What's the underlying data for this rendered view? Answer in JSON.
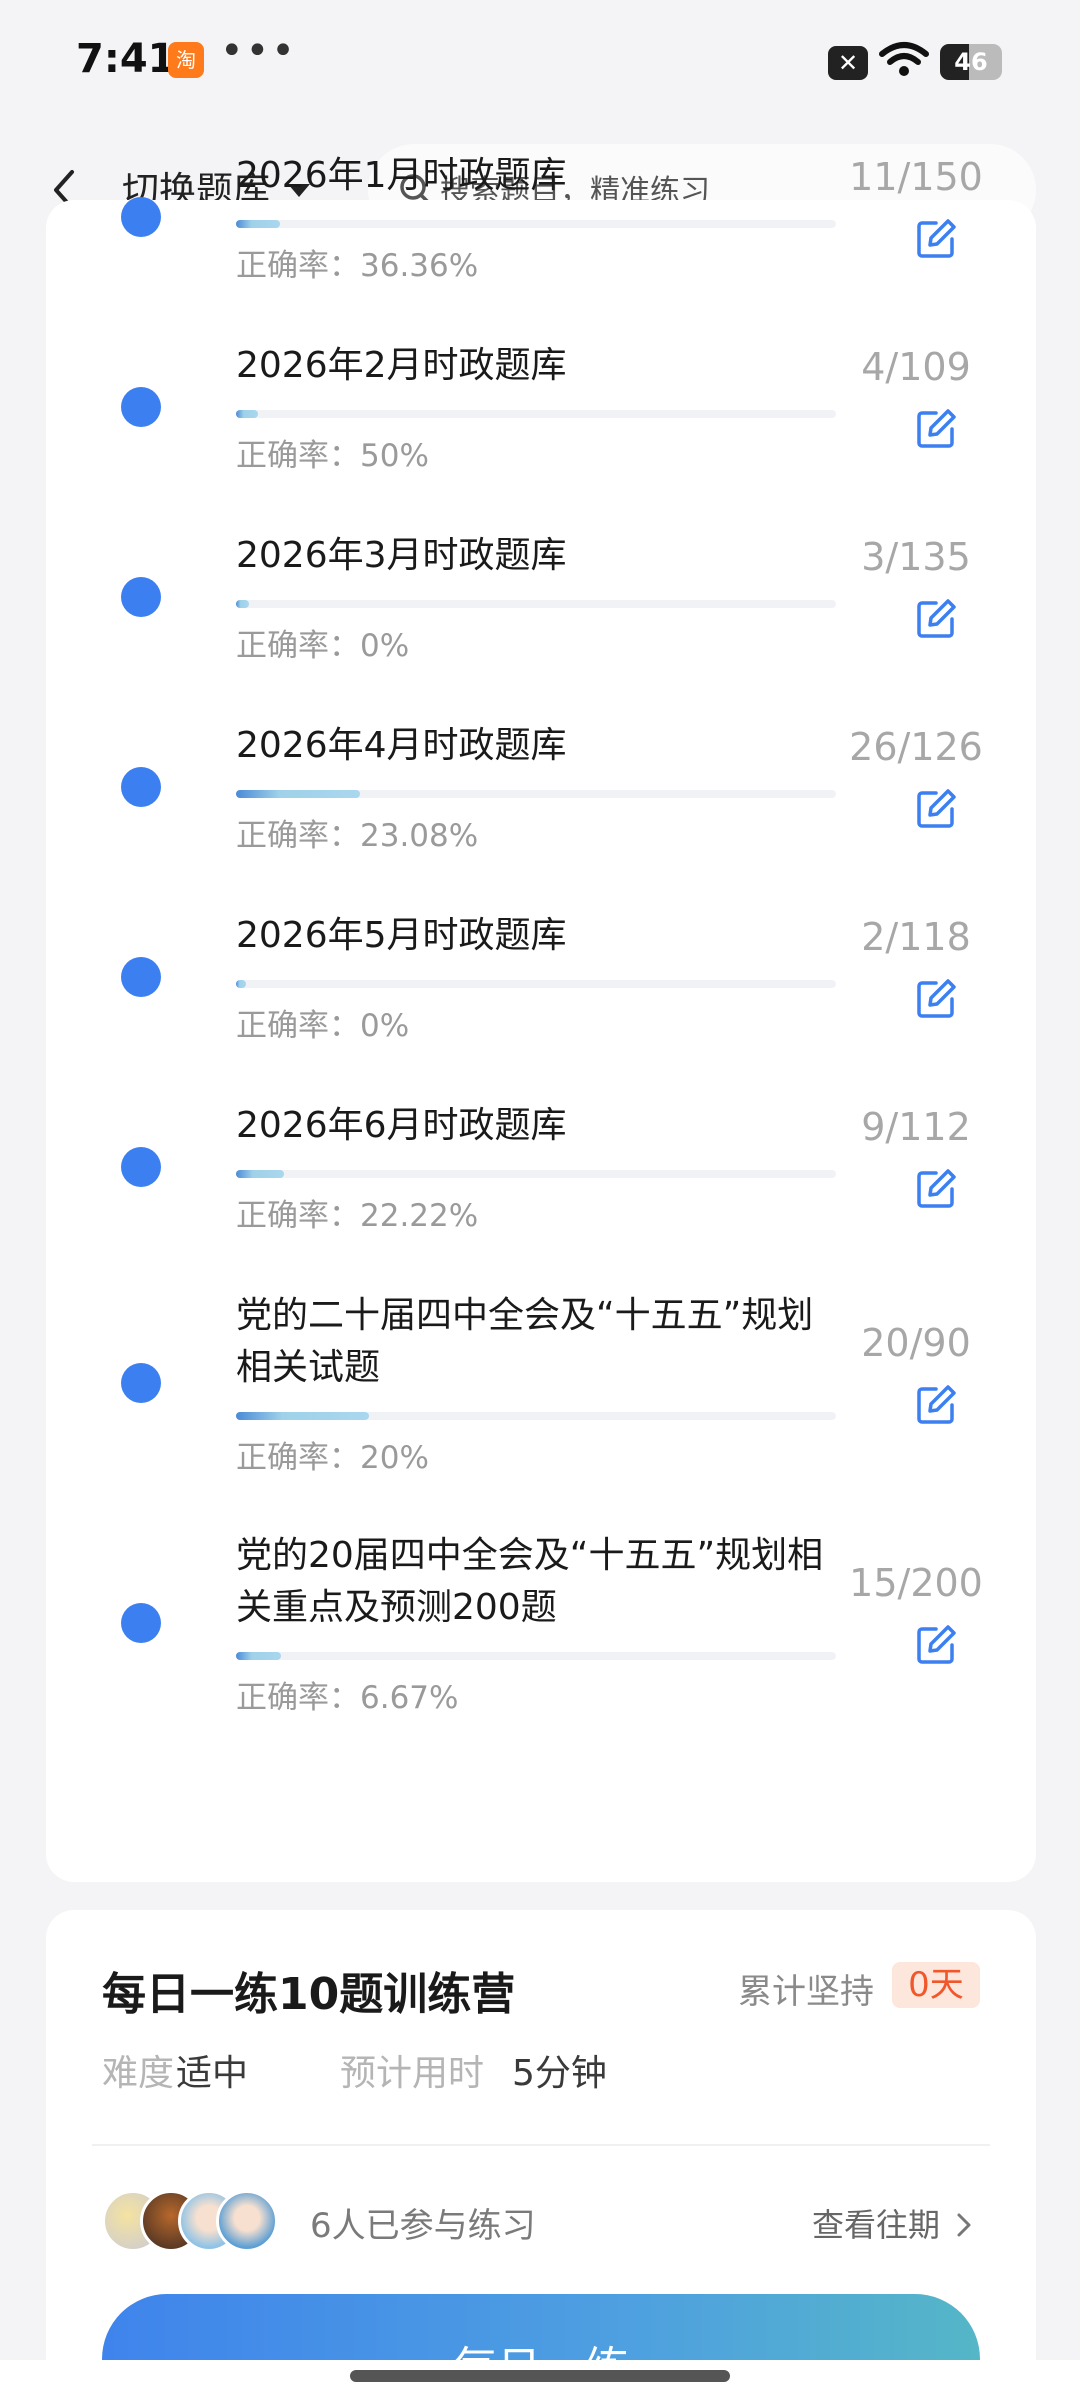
{
  "status_bar": {
    "time": "7:41",
    "app_icon_glyph": "淘",
    "more": "•••",
    "battery": "46"
  },
  "header": {
    "back_icon": "chevron-left-icon",
    "title": "切换题库",
    "search_placeholder": "搜索题目，精准练习"
  },
  "bank_list": {
    "accuracy_prefix": "正确率：",
    "items": [
      {
        "name": "2026年1月时政题库",
        "done": 11,
        "total": 150,
        "count_label": "11/150",
        "accuracy": "36.36%"
      },
      {
        "name": "2026年2月时政题库",
        "done": 4,
        "total": 109,
        "count_label": "4/109",
        "accuracy": "50%"
      },
      {
        "name": "2026年3月时政题库",
        "done": 3,
        "total": 135,
        "count_label": "3/135",
        "accuracy": "0%"
      },
      {
        "name": "2026年4月时政题库",
        "done": 26,
        "total": 126,
        "count_label": "26/126",
        "accuracy": "23.08%"
      },
      {
        "name": "2026年5月时政题库",
        "done": 2,
        "total": 118,
        "count_label": "2/118",
        "accuracy": "0%"
      },
      {
        "name": "2026年6月时政题库",
        "done": 9,
        "total": 112,
        "count_label": "9/112",
        "accuracy": "22.22%"
      },
      {
        "name": "党的二十届四中全会及“十五五”规划相关试题",
        "done": 20,
        "total": 90,
        "count_label": "20/90",
        "accuracy": "20%"
      },
      {
        "name": "党的20届四中全会及“十五五”规划相关重点及预测200题",
        "done": 15,
        "total": 200,
        "count_label": "15/200",
        "accuracy": "6.67%"
      }
    ]
  },
  "daily": {
    "title": "每日一练10题训练营",
    "streak_label": "累计坚持",
    "streak_value": "0天",
    "difficulty_label": "难度",
    "difficulty_value": "适中",
    "time_label": "预计用时",
    "time_value": "5分钟",
    "participants": "6人已参与练习",
    "history_link": "查看往期",
    "cta": "每日一练"
  },
  "colors": {
    "accent": "#3b7ff0",
    "streak": "#f0582c"
  }
}
